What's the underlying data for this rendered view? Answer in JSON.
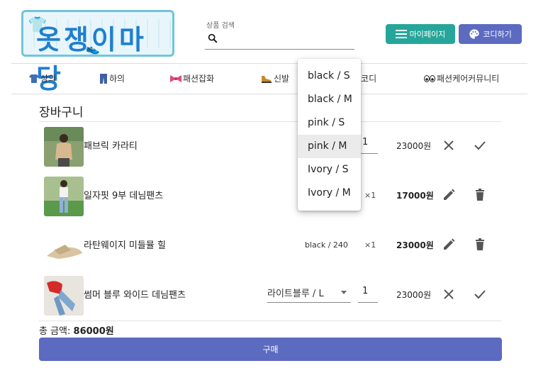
{
  "logo": {
    "text": "옷쟁이마당"
  },
  "search": {
    "label": "상품 검색",
    "value": ""
  },
  "header_buttons": {
    "mypage": "마이페이지",
    "codi": "코디하기"
  },
  "nav": [
    {
      "label": "상의",
      "icon": "shirt-icon"
    },
    {
      "label": "하의",
      "icon": "jeans-icon"
    },
    {
      "label": "패션잡화",
      "icon": "ribbon-icon"
    },
    {
      "label": "신발",
      "icon": "shoe-icon"
    },
    {
      "label": "션코디",
      "icon": ""
    },
    {
      "label": "패션케어커뮤니티",
      "icon": "eyes-icon"
    }
  ],
  "cart": {
    "title": "장바구니",
    "items": [
      {
        "name": "패브릭 카라티",
        "option": "",
        "qty": "1",
        "price": "23000원"
      },
      {
        "name": "일자핏 9부 데님팬츠",
        "option": "",
        "qty": "×1",
        "price": "17000원"
      },
      {
        "name": "라탄웨이지 미들뮬 힐",
        "option": "black / 240",
        "qty": "×1",
        "price": "23000원"
      },
      {
        "name": "썸머 블루 와이드 데님팬츠",
        "option": "라이트블루 / L",
        "qty": "1",
        "price": "23000원"
      }
    ],
    "total_label": "총 금액: ",
    "total_value": "86000원",
    "buy_label": "구매"
  },
  "dropdown": {
    "options": [
      "black / S",
      "black / M",
      "pink / S",
      "pink / M",
      "Ivory / S",
      "Ivory / M"
    ],
    "selected": "pink / M"
  },
  "colors": {
    "teal": "#26a69a",
    "indigo": "#5c6bc0"
  }
}
